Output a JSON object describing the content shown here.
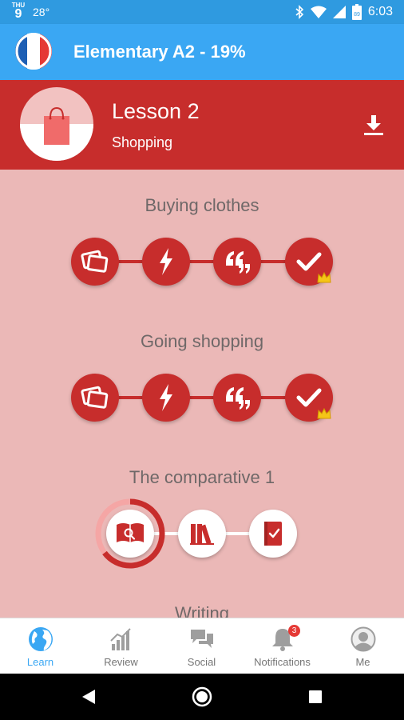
{
  "status_bar": {
    "day_of_week": "THU",
    "day": "9",
    "temperature": "28°",
    "battery": "89",
    "time": "6:03"
  },
  "app_bar": {
    "title": "Elementary A2 - 19%"
  },
  "lesson": {
    "title": "Lesson 2",
    "subtitle": "Shopping"
  },
  "sections": [
    {
      "title": "Buying clothes"
    },
    {
      "title": "Going shopping"
    },
    {
      "title": "The comparative 1"
    },
    {
      "title": "Writing"
    }
  ],
  "bottom_nav": {
    "items": [
      {
        "label": "Learn",
        "icon": "globe-icon",
        "active": true
      },
      {
        "label": "Review",
        "icon": "bar-chart-icon"
      },
      {
        "label": "Social",
        "icon": "chat-icon"
      },
      {
        "label": "Notifications",
        "icon": "bell-icon",
        "badge": "3"
      },
      {
        "label": "Me",
        "icon": "profile-icon"
      }
    ]
  },
  "colors": {
    "primary": "#3aa7f3",
    "lesson_red": "#c72d2c",
    "background_pink": "#ebb8b7",
    "status_blue": "#2f9ae0"
  }
}
